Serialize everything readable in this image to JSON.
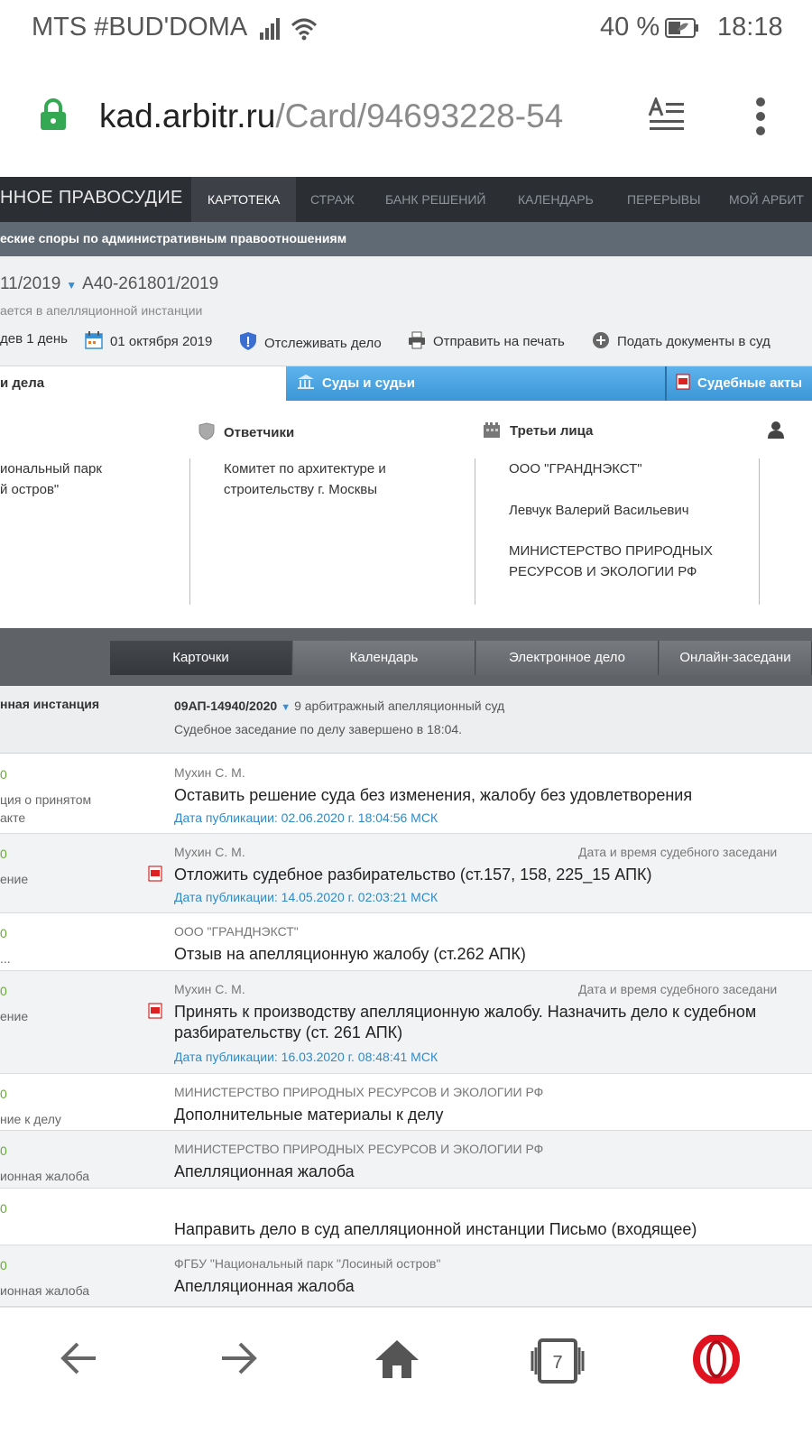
{
  "status_bar": {
    "carrier": "MTS #BUD'DOMA",
    "battery_percent": "40 %",
    "time": "18:18"
  },
  "browser": {
    "url_domain": "kad.arbitr.ru",
    "url_path": "/Card/94693228-54",
    "tab_count": "7"
  },
  "site_nav": {
    "brand": "ННОЕ ПРАВОСУДИЕ",
    "items": [
      "КАРТОТЕКА",
      "СТРАЖ",
      "БАНК РЕШЕНИЙ",
      "КАЛЕНДАРЬ",
      "ПЕРЕРЫВЫ",
      "МОЙ АРБИТ"
    ]
  },
  "category": "еские споры по административным правоотношениям",
  "case": {
    "number_prev": "11/2019",
    "number": "А40-261801/2019",
    "status": "ается в апелляционной инстанции",
    "tools": [
      "дев 1 день",
      "01 октября 2019",
      "Отслеживать дело",
      "Отправить на печать",
      "Подать документы в суд"
    ]
  },
  "tabs": [
    "и дела",
    "Суды и судьи",
    "Судебные акты"
  ],
  "parties": {
    "plaintiff_line1": "иональный парк",
    "plaintiff_line2": "й остров\"",
    "respondents_title": "Ответчики",
    "respondent_line1": "Комитет по архитектуре и",
    "respondent_line2": "строительству г. Москвы",
    "third_title": "Третьи лица",
    "third_1": "ООО \"ГРАНДНЭКСТ\"",
    "third_2": "Левчук Валерий Васильевич",
    "third_3_line1": "МИНИСТЕРСТВО ПРИРОДНЫХ",
    "third_3_line2": "РЕСУРСОВ И ЭКОЛОГИИ РФ"
  },
  "view_tabs": [
    "Карточки",
    "Календарь",
    "Электронное дело",
    "Онлайн-заседани"
  ],
  "instance": {
    "label": "нная инстанция",
    "case_number": "09АП-14940/2020",
    "court": "9 арбитражный апелляционный суд",
    "session": "Судебное заседание по делу завершено в 18:04."
  },
  "events": [
    {
      "date": "0",
      "type1": "ция о принятом",
      "type2": "акте",
      "who": "Мухин С. М.",
      "main": "Оставить решение суда без изменения, жалобу без удовлетворения",
      "pub": "Дата публикации: 02.06.2020 г. 18:04:56 МСК"
    },
    {
      "date": "0",
      "type1": "ение",
      "who": "Мухин С. М.",
      "dt": "Дата и время судебного заседани",
      "main": "Отложить судебное разбирательство (ст.157, 158, 225_15 АПК)",
      "pub": "Дата публикации: 14.05.2020 г. 02:03:21 МСК"
    },
    {
      "date": "0",
      "type1": "...",
      "who": "ООО \"ГРАНДНЭКСТ\"",
      "main": "Отзыв на апелляционную жалобу (ст.262 АПК)"
    },
    {
      "date": "0",
      "type1": "ение",
      "who": "Мухин С. М.",
      "dt": "Дата и время судебного заседани",
      "main1": "Принять к производству апелляционную жалобу. Назначить дело к судебном",
      "main2": "разбирательству (ст. 261 АПК)",
      "pub": "Дата публикации: 16.03.2020 г. 08:48:41 МСК"
    },
    {
      "date": "0",
      "type1": "ние к делу",
      "who": "МИНИСТЕРСТВО ПРИРОДНЫХ РЕСУРСОВ И ЭКОЛОГИИ РФ",
      "main": "Дополнительные материалы к делу"
    },
    {
      "date": "0",
      "type1": "ионная жалоба",
      "who": "МИНИСТЕРСТВО ПРИРОДНЫХ РЕСУРСОВ И ЭКОЛОГИИ РФ",
      "main": "Апелляционная жалоба"
    },
    {
      "date": "0",
      "main": "Направить дело в суд апелляционной инстанции Письмо (входящее)"
    },
    {
      "date": "0",
      "type1": "ионная жалоба",
      "who": "ФГБУ \"Национальный парк \"Лосиный остров\"",
      "main": "Апелляционная жалоба"
    }
  ],
  "colors": {
    "nav_bg": "#2b2e33",
    "tab_blue": "#3c96d6",
    "date_green": "#6aa83a",
    "link_blue": "#2d8bc9",
    "opera_red": "#e0121f",
    "lock_green": "#34a853"
  }
}
